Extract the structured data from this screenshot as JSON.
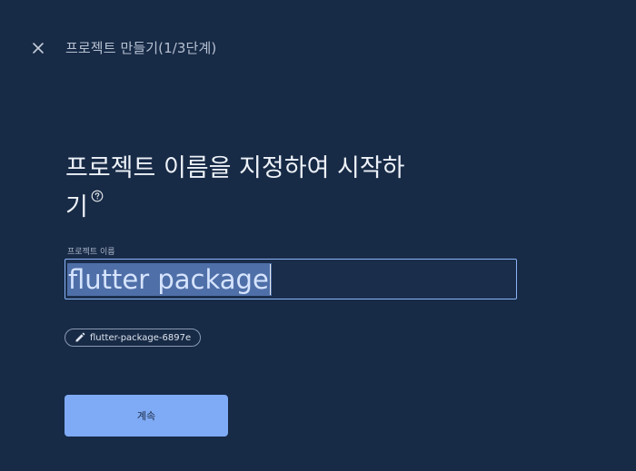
{
  "header": {
    "close_icon": "close-icon",
    "step_title": "프로젝트 만들기(1/3단계)"
  },
  "main": {
    "heading_line1": "프로젝트 이름을 지정하여 시작하",
    "heading_line2": "기",
    "help_icon": "help-circle-icon",
    "field_label": "프로젝트 이름",
    "project_name_value": "flutter package",
    "project_id_chip": "flutter-package-6897e",
    "chip_icon": "pencil-icon",
    "continue_label": "계속"
  },
  "colors": {
    "background": "#172a46",
    "accent": "#8ab4f8",
    "button": "#7faaf5"
  }
}
